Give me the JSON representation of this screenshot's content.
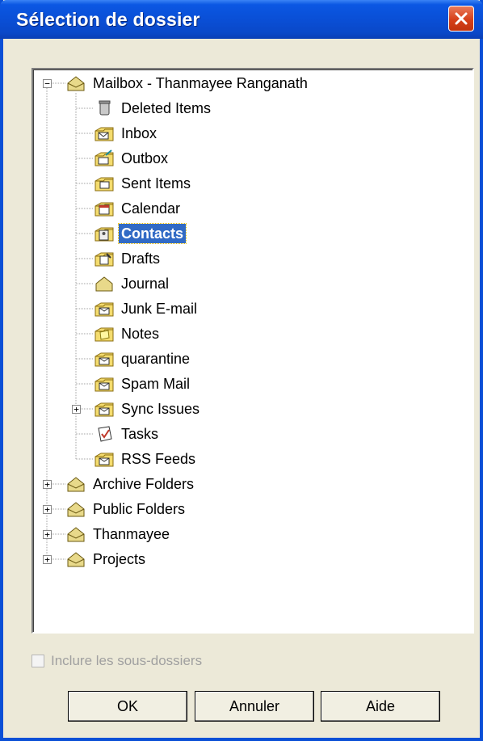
{
  "window": {
    "title": "Sélection de dossier"
  },
  "tree": {
    "root": {
      "label": "Mailbox - Thanmayee Ranganath",
      "icon": "mailbox-folder-icon",
      "expanded": true
    },
    "children": [
      {
        "label": "Deleted Items",
        "icon": "trash-folder-icon"
      },
      {
        "label": "Inbox",
        "icon": "inbox-folder-icon"
      },
      {
        "label": "Outbox",
        "icon": "outbox-folder-icon"
      },
      {
        "label": "Sent Items",
        "icon": "sent-folder-icon"
      },
      {
        "label": "Calendar",
        "icon": "calendar-folder-icon"
      },
      {
        "label": "Contacts",
        "icon": "contacts-folder-icon",
        "selected": true
      },
      {
        "label": "Drafts",
        "icon": "drafts-folder-icon"
      },
      {
        "label": "Journal",
        "icon": "journal-folder-icon"
      },
      {
        "label": "Junk E-mail",
        "icon": "mail-folder-icon"
      },
      {
        "label": "Notes",
        "icon": "notes-folder-icon"
      },
      {
        "label": "quarantine",
        "icon": "mail-folder-icon"
      },
      {
        "label": "Spam Mail",
        "icon": "mail-folder-icon"
      },
      {
        "label": "Sync Issues",
        "icon": "mail-folder-icon",
        "expandable": true
      },
      {
        "label": "Tasks",
        "icon": "tasks-folder-icon"
      },
      {
        "label": "RSS Feeds",
        "icon": "mail-folder-icon"
      }
    ],
    "top_level": [
      {
        "label": "Archive Folders",
        "icon": "mailbox-folder-icon"
      },
      {
        "label": "Public Folders",
        "icon": "mailbox-folder-icon"
      },
      {
        "label": "Thanmayee",
        "icon": "mailbox-folder-icon"
      },
      {
        "label": "Projects",
        "icon": "mailbox-folder-icon"
      }
    ]
  },
  "checkbox": {
    "label": "Inclure les sous-dossiers",
    "checked": false,
    "enabled": false
  },
  "buttons": {
    "ok": "OK",
    "cancel": "Annuler",
    "help": "Aide"
  },
  "colors": {
    "titlebar": "#0a4fd6",
    "selection": "#316ac5",
    "dialog_bg": "#ece9d8"
  }
}
